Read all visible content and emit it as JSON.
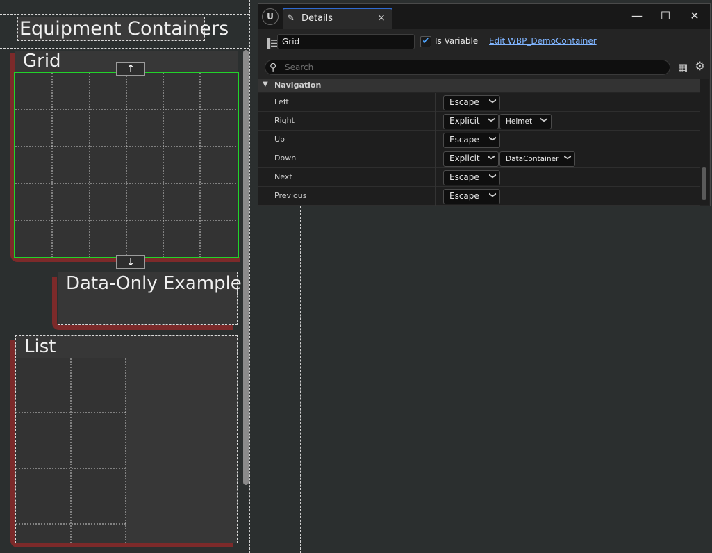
{
  "canvas": {
    "header_title": "Equipment Containers",
    "grid_title": "Grid",
    "data_only_title": "Data-Only Example",
    "list_title": "List",
    "scroll_up_glyph": "↑",
    "scroll_down_glyph": "↓",
    "selection_color": "#22d32a",
    "frame_color": "#7c2a2a"
  },
  "details": {
    "logo": "U",
    "tab_title": "Details",
    "tab_close": "×",
    "window_buttons": {
      "minimize": "—",
      "maximize": "☐",
      "close": "✕"
    },
    "name_value": "Grid",
    "is_variable_label": "Is Variable",
    "is_variable_checked": true,
    "edit_link": "Edit WBP_DemoContainer",
    "search_placeholder": "Search",
    "section": "Navigation",
    "rows": [
      {
        "label": "Left",
        "rule": "Escape",
        "target": ""
      },
      {
        "label": "Right",
        "rule": "Explicit",
        "target": "Helmet"
      },
      {
        "label": "Up",
        "rule": "Escape",
        "target": ""
      },
      {
        "label": "Down",
        "rule": "Explicit",
        "target": "DataContainer"
      },
      {
        "label": "Next",
        "rule": "Escape",
        "target": ""
      },
      {
        "label": "Previous",
        "rule": "Escape",
        "target": ""
      }
    ]
  }
}
